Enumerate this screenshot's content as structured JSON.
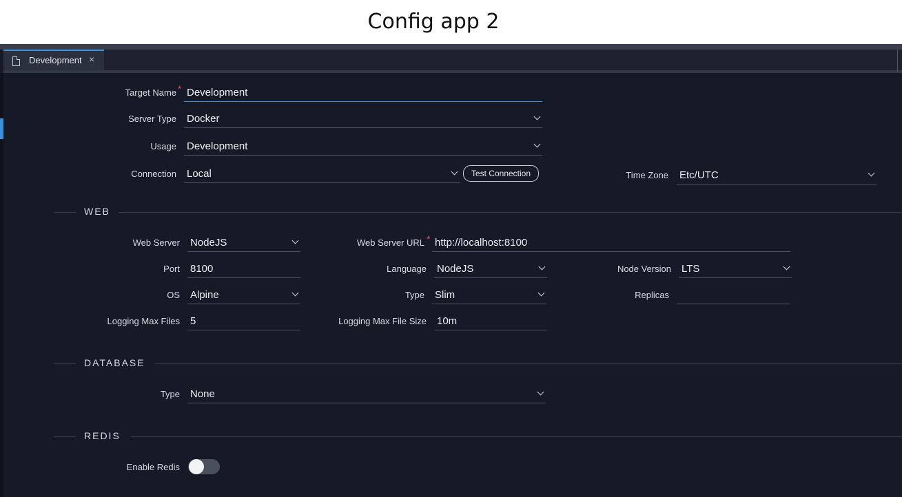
{
  "caption": "Config app 2",
  "tab": {
    "label": "Development",
    "close": "×"
  },
  "target": {
    "target_name": {
      "label": "Target Name",
      "required": "*",
      "value": "Development"
    },
    "server_type": {
      "label": "Server Type",
      "value": "Docker"
    },
    "usage": {
      "label": "Usage",
      "value": "Development"
    },
    "connection": {
      "label": "Connection",
      "value": "Local",
      "test_button": "Test Connection"
    },
    "time_zone": {
      "label": "Time Zone",
      "value": "Etc/UTC"
    }
  },
  "web": {
    "title": "WEB",
    "web_server": {
      "label": "Web Server",
      "value": "NodeJS"
    },
    "web_server_url": {
      "label": "Web Server URL",
      "required": "*",
      "value": "http://localhost:8100"
    },
    "port": {
      "label": "Port",
      "value": "8100"
    },
    "language": {
      "label": "Language",
      "value": "NodeJS"
    },
    "node_version": {
      "label": "Node Version",
      "value": "LTS"
    },
    "os": {
      "label": "OS",
      "value": "Alpine"
    },
    "type": {
      "label": "Type",
      "value": "Slim"
    },
    "replicas": {
      "label": "Replicas",
      "value": ""
    },
    "logging_max_files": {
      "label": "Logging Max Files",
      "value": "5"
    },
    "logging_max_file_size": {
      "label": "Logging Max File Size",
      "value": "10m"
    }
  },
  "database": {
    "title": "DATABASE",
    "type": {
      "label": "Type",
      "value": "None"
    }
  },
  "redis": {
    "title": "REDIS",
    "enable": {
      "label": "Enable Redis",
      "enabled": false
    }
  },
  "colors": {
    "accent": "#3d8fd9",
    "background": "#161a26",
    "required": "#e05555"
  }
}
